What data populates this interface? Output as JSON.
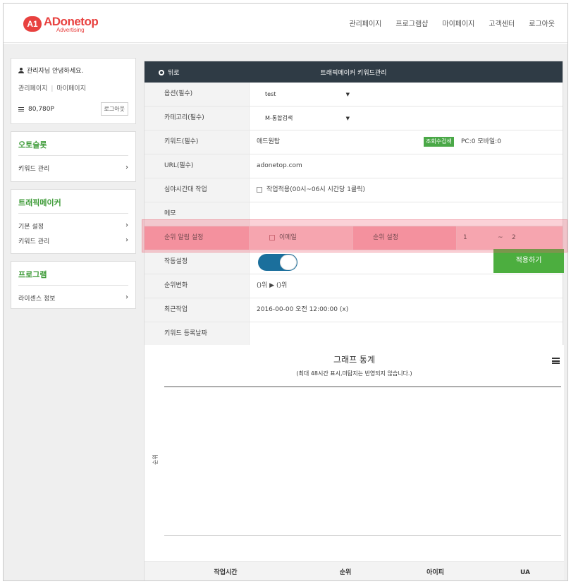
{
  "header": {
    "logo": {
      "badge": "A1",
      "main": "ADonetop",
      "sub": "Advertising"
    },
    "nav": [
      "관리페이지",
      "프로그램샵",
      "마이페이지",
      "고객센터",
      "로그아웃"
    ]
  },
  "sidebar": {
    "greeting": "관리자님 안녕하세요.",
    "admin_link": "관리페이지",
    "mypage_link": "마이페이지",
    "points": "80,780P",
    "logout": "로그아웃",
    "sections": [
      {
        "title": "오토슬롯",
        "items": [
          "키워드 관리"
        ]
      },
      {
        "title": "트래픽메이커",
        "items": [
          "기본 설정",
          "키워드 관리"
        ]
      },
      {
        "title": "프로그램",
        "items": [
          "라이센스 정보"
        ]
      }
    ]
  },
  "panel": {
    "back": "뒤로",
    "title": "트래픽메이커 키워드관리",
    "option_label": "옵션(필수)",
    "option_value": "test",
    "category_label": "카테고리(필수)",
    "category_value": "M-통합검색",
    "keyword_label": "키워드(필수)",
    "keyword_value": "애드원탑",
    "search_btn": "조회수검색",
    "pc_mobile": "PC:0 모바일:0",
    "url_label": "URL(필수)",
    "url_value": "adonetop.com",
    "night_label": "심야시간대 작업",
    "night_value": "작업적용(00시~06시 시간당 1클릭)",
    "memo_label": "메모",
    "rank_alarm_label": "순위 알림 설정",
    "rank_email": "이메일",
    "rank_setting_label": "순위 설정",
    "rank_from": "1",
    "rank_tilde": "~",
    "rank_to": "2",
    "operation_label": "작동설정",
    "apply_btn": "적용하기",
    "rank_change_label": "순위변화",
    "rank_change_value": "()위 ▶ ()위",
    "recent_label": "최근작업",
    "recent_value": "2016-00-00 오전 12:00:00 (x)",
    "regdate_label": "키워드 등록날짜"
  },
  "chart_data": {
    "type": "line",
    "title": "그래프 통계",
    "subtitle": "(최대 48시간 표시,미탐지는 반영되지 않습니다.)",
    "ylabel": "순위",
    "series": []
  },
  "table": {
    "columns": [
      "작업시간",
      "순위",
      "아이피",
      "UA"
    ]
  }
}
